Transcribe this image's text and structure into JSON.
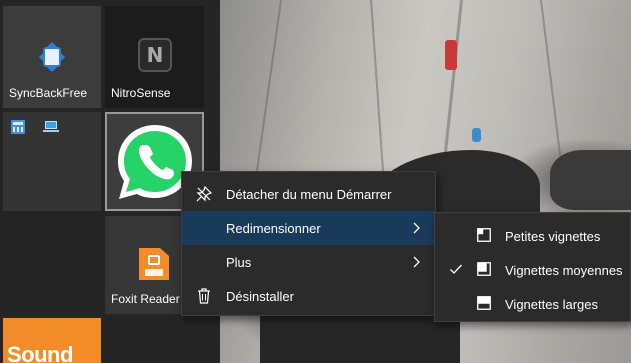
{
  "tiles": {
    "syncback": {
      "label": "SyncBackFree"
    },
    "nitrosense": {
      "label": "NitroSense",
      "glyph": "N"
    },
    "foxit": {
      "label": "Foxit Reader"
    },
    "sound": {
      "label": "Sound"
    }
  },
  "context_menu": {
    "items": [
      {
        "label": "Détacher du menu Démarrer",
        "icon": "unpin-icon"
      },
      {
        "label": "Redimensionner",
        "icon": "",
        "submenu": true,
        "highlighted": true
      },
      {
        "label": "Plus",
        "icon": "",
        "submenu": true
      },
      {
        "label": "Désinstaller",
        "icon": "trash-icon"
      }
    ]
  },
  "resize_submenu": {
    "items": [
      {
        "label": "Petites vignettes",
        "icon": "small-tile-icon",
        "checked": false
      },
      {
        "label": "Vignettes moyennes",
        "icon": "medium-tile-icon",
        "checked": true
      },
      {
        "label": "Vignettes larges",
        "icon": "wide-tile-icon",
        "checked": false
      }
    ]
  },
  "colors": {
    "menu_bg": "#2b2b2b",
    "highlight": "#1a3a5c",
    "whatsapp_green": "#25d366",
    "foxit_orange": "#f28c28"
  }
}
